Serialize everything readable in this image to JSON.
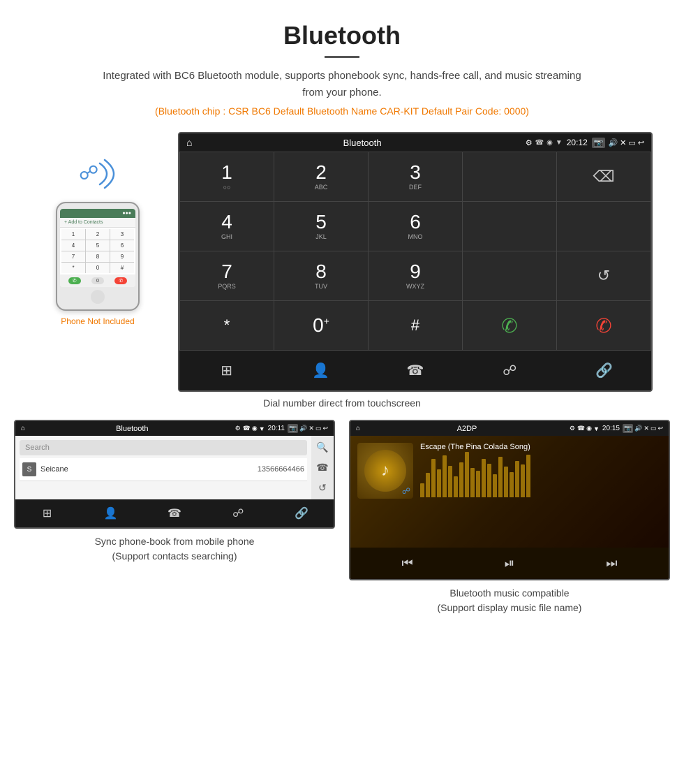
{
  "page": {
    "title": "Bluetooth",
    "description": "Integrated with BC6 Bluetooth module, supports phonebook sync, hands-free call, and music streaming from your phone.",
    "specs_line": "(Bluetooth chip : CSR BC6    Default Bluetooth Name CAR-KIT    Default Pair Code: 0000)"
  },
  "phone_area": {
    "not_included_label": "Phone Not Included"
  },
  "dial_screen": {
    "title": "Bluetooth",
    "time": "20:12",
    "keys": [
      {
        "num": "1",
        "sub": ""
      },
      {
        "num": "2",
        "sub": "ABC"
      },
      {
        "num": "3",
        "sub": "DEF"
      },
      {
        "num": "",
        "sub": ""
      },
      {
        "num": "⌫",
        "sub": ""
      },
      {
        "num": "4",
        "sub": "GHI"
      },
      {
        "num": "5",
        "sub": "JKL"
      },
      {
        "num": "6",
        "sub": "MNO"
      },
      {
        "num": "",
        "sub": ""
      },
      {
        "num": "",
        "sub": ""
      },
      {
        "num": "7",
        "sub": "PQRS"
      },
      {
        "num": "8",
        "sub": "TUV"
      },
      {
        "num": "9",
        "sub": "WXYZ"
      },
      {
        "num": "",
        "sub": ""
      },
      {
        "num": "↺",
        "sub": ""
      },
      {
        "num": "*",
        "sub": ""
      },
      {
        "num": "0",
        "sub": "+"
      },
      {
        "num": "#",
        "sub": ""
      },
      {
        "num": "📞",
        "sub": ""
      },
      {
        "num": "📞",
        "sub": "red"
      }
    ],
    "caption": "Dial number direct from touchscreen"
  },
  "phonebook_screen": {
    "title": "Bluetooth",
    "time": "20:11",
    "search_placeholder": "Search",
    "contact_name": "Seicane",
    "contact_phone": "13566664466",
    "contact_letter": "S",
    "caption_line1": "Sync phone-book from mobile phone",
    "caption_line2": "(Support contacts searching)"
  },
  "music_screen": {
    "title": "A2DP",
    "time": "20:15",
    "song_title": "Escape (The Pina Colada Song)",
    "caption_line1": "Bluetooth music compatible",
    "caption_line2": "(Support display music file name)"
  },
  "eq_bars": [
    20,
    35,
    55,
    40,
    60,
    45,
    30,
    50,
    65,
    42,
    38,
    55,
    48,
    33,
    58,
    44,
    36,
    52,
    47,
    61
  ]
}
